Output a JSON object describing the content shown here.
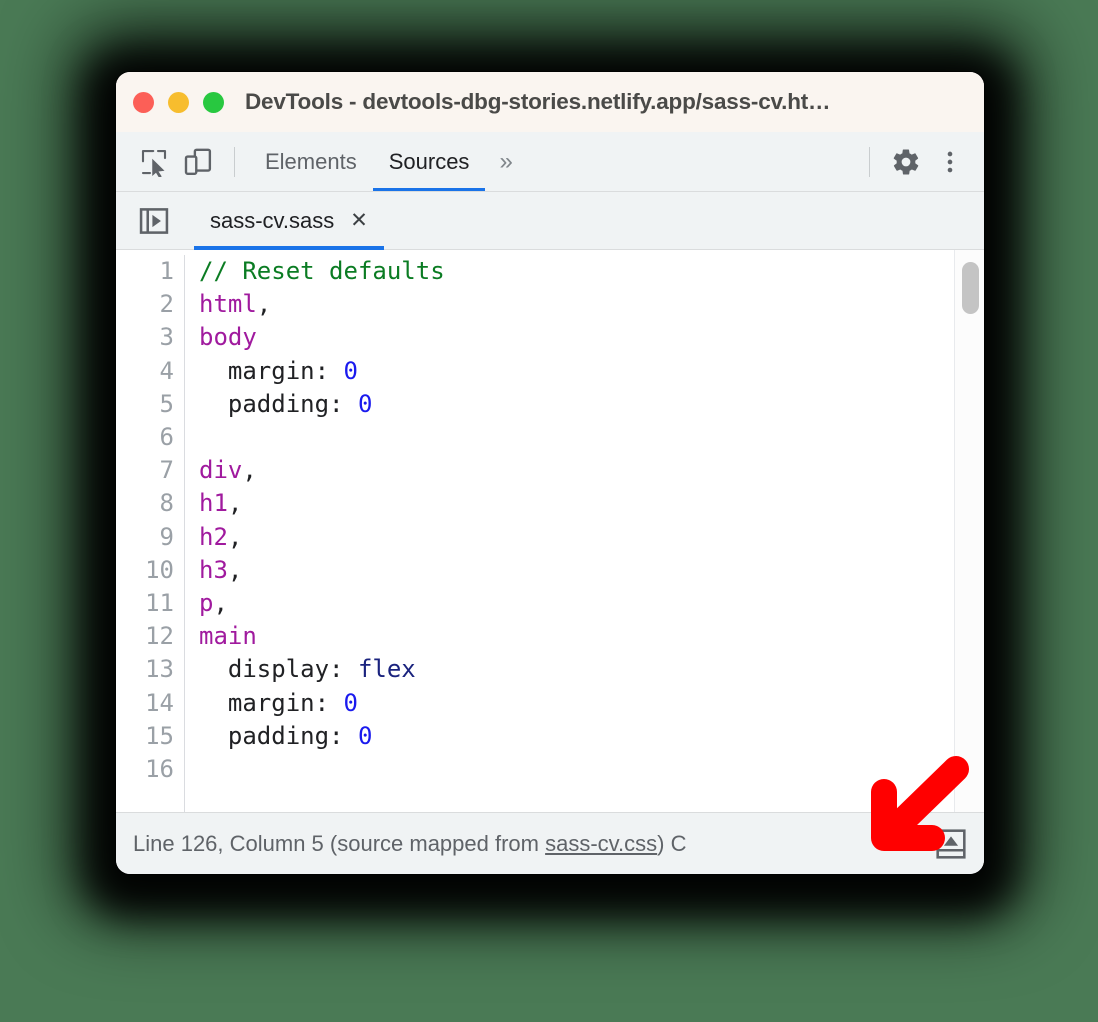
{
  "window": {
    "title": "DevTools - devtools-dbg-stories.netlify.app/sass-cv.ht…",
    "traffic_lights": {
      "close": "close-window",
      "minimize": "minimize-window",
      "zoom": "zoom-window"
    },
    "colors": {
      "titlebar_bg": "#FAF5F0",
      "toolbar_bg": "#F0F3F4",
      "accent_blue": "#1A73E8",
      "red_light": "#FC5F57",
      "yellow_light": "#F7BD2E",
      "green_light": "#28C840",
      "annotation_red": "#FF0000"
    }
  },
  "toolbar": {
    "inspect_icon": "inspect-element-icon",
    "device_icon": "device-toolbar-icon",
    "panels": [
      {
        "label": "Elements",
        "active": false
      },
      {
        "label": "Sources",
        "active": true
      }
    ],
    "overflow_label": "»",
    "settings_icon": "gear-icon",
    "more_icon": "more-vertical-icon"
  },
  "file_tabstrip": {
    "navigator_icon": "show-navigator-icon",
    "tab": {
      "name": "sass-cv.sass",
      "close_label": "✕",
      "active": true
    }
  },
  "editor": {
    "line_numbers": [
      "1",
      "2",
      "3",
      "4",
      "5",
      "6",
      "7",
      "8",
      "9",
      "10",
      "11",
      "12",
      "13",
      "14",
      "15",
      "16"
    ],
    "lines": [
      {
        "n": "1",
        "tokens": [
          {
            "t": "// Reset defaults",
            "c": "tok-comment"
          }
        ]
      },
      {
        "n": "2",
        "tokens": [
          {
            "t": "html",
            "c": "tok-selector"
          },
          {
            "t": ",",
            "c": "tok-plain"
          }
        ]
      },
      {
        "n": "3",
        "tokens": [
          {
            "t": "body",
            "c": "tok-selector"
          }
        ]
      },
      {
        "n": "4",
        "tokens": [
          {
            "t": "  margin: ",
            "c": "tok-prop"
          },
          {
            "t": "0",
            "c": "tok-number"
          }
        ]
      },
      {
        "n": "5",
        "tokens": [
          {
            "t": "  padding: ",
            "c": "tok-prop"
          },
          {
            "t": "0",
            "c": "tok-number"
          }
        ]
      },
      {
        "n": "6",
        "tokens": [
          {
            "t": " ",
            "c": "tok-plain"
          }
        ]
      },
      {
        "n": "7",
        "tokens": [
          {
            "t": "div",
            "c": "tok-selector"
          },
          {
            "t": ",",
            "c": "tok-plain"
          }
        ]
      },
      {
        "n": "8",
        "tokens": [
          {
            "t": "h1",
            "c": "tok-selector"
          },
          {
            "t": ",",
            "c": "tok-plain"
          }
        ]
      },
      {
        "n": "9",
        "tokens": [
          {
            "t": "h2",
            "c": "tok-selector"
          },
          {
            "t": ",",
            "c": "tok-plain"
          }
        ]
      },
      {
        "n": "10",
        "tokens": [
          {
            "t": "h3",
            "c": "tok-selector"
          },
          {
            "t": ",",
            "c": "tok-plain"
          }
        ]
      },
      {
        "n": "11",
        "tokens": [
          {
            "t": "p",
            "c": "tok-selector"
          },
          {
            "t": ",",
            "c": "tok-plain"
          }
        ]
      },
      {
        "n": "12",
        "tokens": [
          {
            "t": "main",
            "c": "tok-selector"
          }
        ]
      },
      {
        "n": "13",
        "tokens": [
          {
            "t": "  display: ",
            "c": "tok-prop"
          },
          {
            "t": "flex",
            "c": "tok-value"
          }
        ]
      },
      {
        "n": "14",
        "tokens": [
          {
            "t": "  margin: ",
            "c": "tok-prop"
          },
          {
            "t": "0",
            "c": "tok-number"
          }
        ]
      },
      {
        "n": "15",
        "tokens": [
          {
            "t": "  padding: ",
            "c": "tok-prop"
          },
          {
            "t": "0",
            "c": "tok-number"
          }
        ]
      },
      {
        "n": "16",
        "tokens": [
          {
            "t": " ",
            "c": "tok-plain"
          }
        ]
      }
    ],
    "scrollbar": "vertical-scrollbar"
  },
  "status_bar": {
    "prefix": "Line 126, Column 5  (source mapped from ",
    "source_link": "sass-cv.css",
    "suffix": ") C",
    "pretty_print_icon": "pretty-print-icon"
  },
  "annotation": {
    "arrow_icon": "red-arrow-down-left",
    "color": "#FF0000"
  }
}
